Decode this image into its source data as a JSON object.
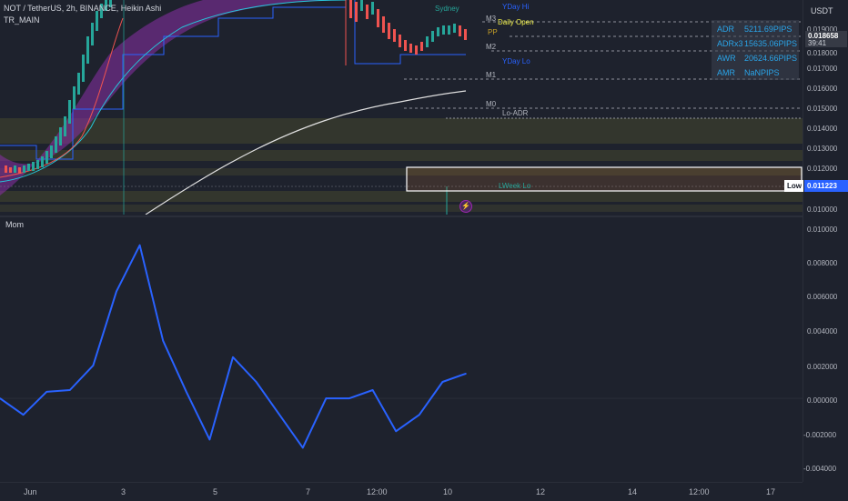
{
  "header": {
    "symbol_title": "NOT / TetherUS, 2h, BINANCE, Heikin Ashi",
    "indicator": "TR_MAIN"
  },
  "momentum": {
    "title": "Mom"
  },
  "currency": "USDT",
  "price_axis": {
    "ticks": [
      "0.019000",
      "0.018000",
      "0.017000",
      "0.016000",
      "0.015000",
      "0.014000",
      "0.013000",
      "0.012000",
      "0.011000",
      "0.010000"
    ],
    "current_price": "0.018658",
    "countdown": "39:41",
    "low_label": "Low",
    "low_value": "0.011223"
  },
  "mom_axis": {
    "ticks": [
      "0.010000",
      "0.008000",
      "0.006000",
      "0.004000",
      "0.002000",
      "0.000000",
      "-0.002000",
      "-0.004000"
    ]
  },
  "time_axis": {
    "ticks": [
      "Jun",
      "3",
      "5",
      "7",
      "12:00",
      "10",
      "12",
      "14",
      "12:00",
      "17"
    ]
  },
  "levels": {
    "m3": "M3",
    "daily_open": "Daily Open",
    "pp": "PP",
    "m2": "M2",
    "yday_lo": "YDay Lo",
    "m1": "M1",
    "m0": "M0",
    "lo_adr": "Lo-ADR",
    "lweek_lo": "LWeek Lo",
    "yday_hi": "YDay Hi",
    "sydney": "Sydney"
  },
  "stats": [
    {
      "name": "ADR",
      "value": "5211.69PIPS"
    },
    {
      "name": "ADRx3",
      "value": "15635.06PIPS"
    },
    {
      "name": "AWR",
      "value": "20624.66PIPS"
    },
    {
      "name": "AMR",
      "value": "NaNPIPS"
    }
  ],
  "colors": {
    "background": "#1e222d",
    "momentum_line": "#2962ff",
    "bull_candle": "#26a69a",
    "bear_candle": "#ef5350",
    "zone": "#3b3d2e",
    "cloud": "#8b2fa8",
    "level_text": "#2aa4e8",
    "daily_open": "#f3f34a"
  },
  "chart_data": {
    "type": "line",
    "title": "Mom",
    "x": [
      "Jun",
      "",
      "",
      "",
      "",
      "3",
      "",
      "",
      "",
      "",
      "5",
      "",
      "",
      "",
      "",
      "7",
      "",
      "12:00",
      "",
      "",
      "10"
    ],
    "series": [
      {
        "name": "Mom",
        "values": [
          0.0,
          -0.001,
          0.0004,
          0.0005,
          0.002,
          0.0065,
          0.0093,
          0.0035,
          0.0004,
          -0.0025,
          0.0025,
          0.001,
          -0.001,
          -0.003,
          0.0,
          0.0,
          0.0005,
          -0.002,
          -0.001,
          0.001,
          0.0015
        ]
      }
    ],
    "ylim": [
      -0.0048,
      0.0105
    ]
  }
}
